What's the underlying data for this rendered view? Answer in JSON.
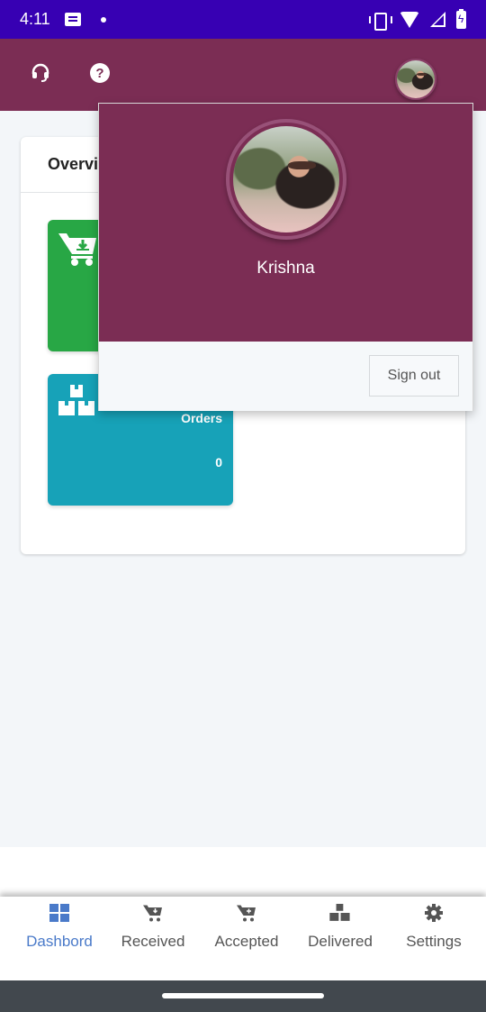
{
  "status_bar": {
    "time": "4:11",
    "icons": [
      "message-icon",
      "dot-icon",
      "vibrate-icon",
      "wifi-icon",
      "signal-icon",
      "battery-charging-icon"
    ]
  },
  "header": {
    "icons": [
      "headset-icon",
      "help-icon"
    ],
    "help_glyph": "?",
    "avatar": "profile-avatar"
  },
  "overview": {
    "title": "Overview",
    "tiles": [
      {
        "icon": "cart-download-icon",
        "label": "",
        "value": "",
        "color": "#28a745"
      },
      {
        "icon": "boxes-icon",
        "label": "Orders",
        "value": "0",
        "color": "#17a2b8"
      }
    ]
  },
  "profile_menu": {
    "name": "Krishna",
    "sign_out_label": "Sign out"
  },
  "bottom_nav": {
    "items": [
      {
        "label": "Dashbord",
        "icon": "dashboard-grid-icon",
        "active": true
      },
      {
        "label": "Received",
        "icon": "cart-download-icon",
        "active": false
      },
      {
        "label": "Accepted",
        "icon": "cart-plus-icon",
        "active": false
      },
      {
        "label": "Delivered",
        "icon": "boxes-icon",
        "active": false
      },
      {
        "label": "Settings",
        "icon": "gear-icon",
        "active": false
      }
    ]
  },
  "colors": {
    "status_bar": "#3700b3",
    "brand": "#7b2d54",
    "success": "#28a745",
    "info": "#17a2b8",
    "nav_active": "#4a7ac9"
  }
}
